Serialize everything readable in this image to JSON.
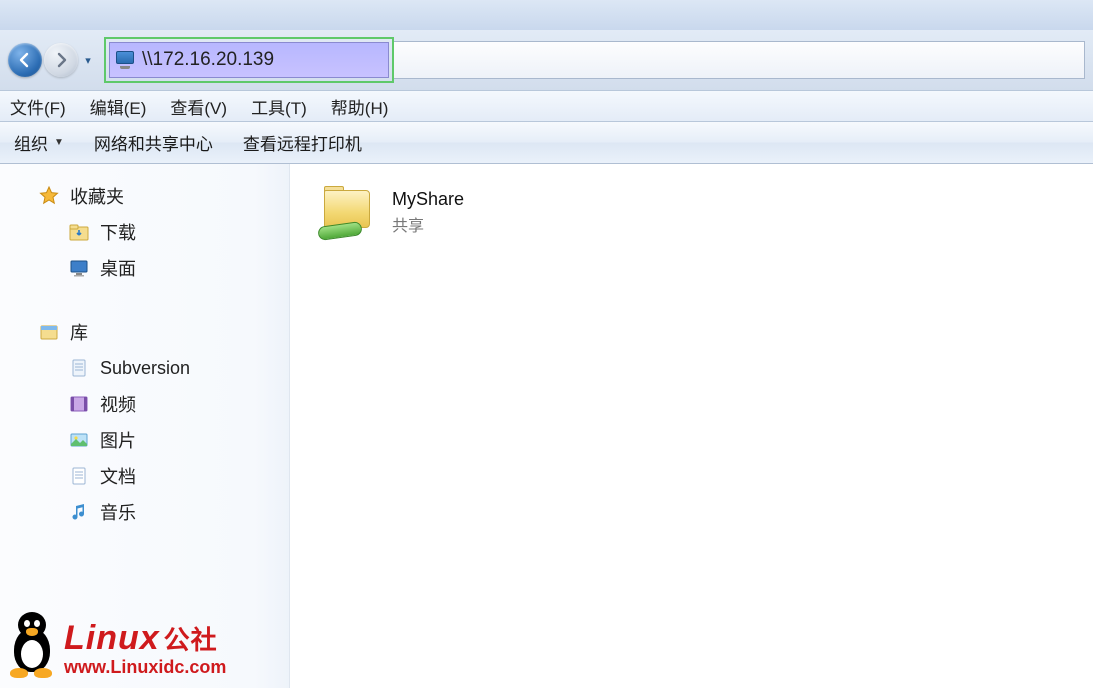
{
  "title_area": {},
  "nav": {
    "back_icon": "arrow-left",
    "forward_icon": "arrow-right",
    "address": "\\\\172.16.20.139"
  },
  "menu": {
    "file": "文件(F)",
    "edit": "编辑(E)",
    "view": "查看(V)",
    "tools": "工具(T)",
    "help": "帮助(H)"
  },
  "toolbar": {
    "organize": "组织",
    "network_center": "网络和共享中心",
    "view_printers": "查看远程打印机"
  },
  "sidebar": {
    "favorites": {
      "label": "收藏夹",
      "items": [
        {
          "icon": "download-folder",
          "label": "下载"
        },
        {
          "icon": "desktop",
          "label": "桌面"
        }
      ]
    },
    "libraries": {
      "label": "库",
      "items": [
        {
          "icon": "doc-lib",
          "label": "Subversion"
        },
        {
          "icon": "video-lib",
          "label": "视频"
        },
        {
          "icon": "picture-lib",
          "label": "图片"
        },
        {
          "icon": "document-lib",
          "label": "文档"
        },
        {
          "icon": "music-lib",
          "label": "音乐"
        }
      ]
    }
  },
  "content": {
    "items": [
      {
        "name": "MyShare",
        "subtitle": "共享",
        "icon": "shared-folder"
      }
    ]
  },
  "watermark": {
    "brand": "Linux",
    "brand_cn": "公社",
    "url": "www.Linuxidc.com"
  }
}
